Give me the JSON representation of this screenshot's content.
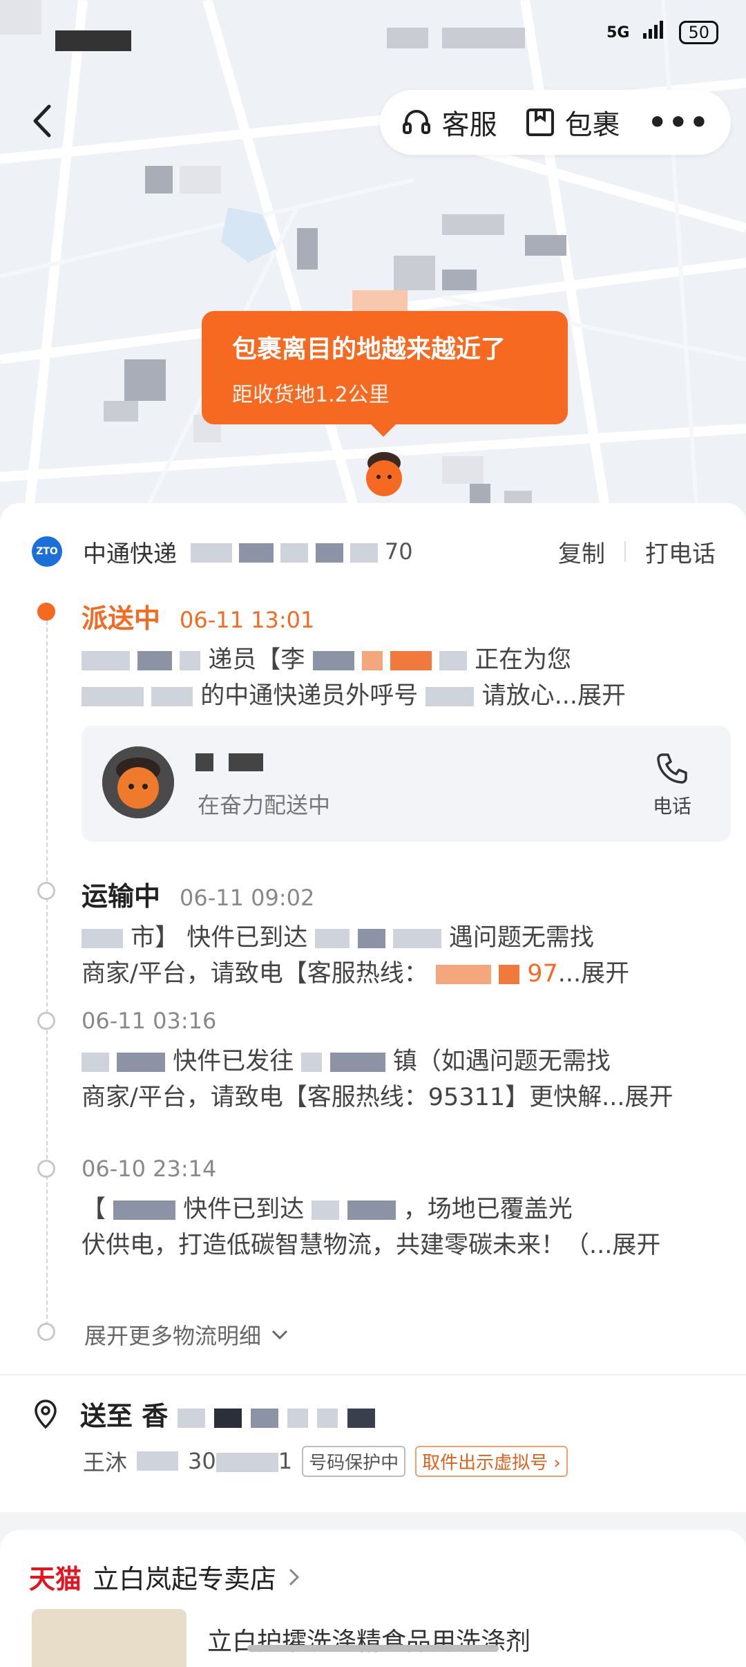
{
  "status_bar": {
    "network": "5G",
    "battery": "50"
  },
  "header": {
    "service_label": "客服",
    "package_label": "包裹",
    "more_label": "•••"
  },
  "map": {
    "bubble_title": "包裹离目的地越来越近了",
    "bubble_subtitle": "距收货地1.2公里"
  },
  "carrier": {
    "name": "中通快递",
    "tracking_suffix": "70",
    "copy_label": "复制",
    "call_label": "打电话",
    "logo_text": "ZTO"
  },
  "events": [
    {
      "status": "派送中",
      "time": "06-11 13:01",
      "line1_mid": "递员【李",
      "line1_end": "正在为您",
      "line2_mid": "的中通快递员外呼号",
      "line2_end": "请放心...展开"
    },
    {
      "status": "运输中",
      "time": "06-11 09:02",
      "line1_a": "市】",
      "line1_b": "快件已到达",
      "line1_c": "遇问题无需找",
      "line2_a": "商家/平台，请致电【客服热线：",
      "line2_b": "97",
      "line2_c": "...展开"
    },
    {
      "status": "",
      "time": "06-11 03:16",
      "line1_b": "快件已发往",
      "line1_c": "镇（如遇问题无需找",
      "line2_a": "商家/平台，请致电【客服热线：95311】更快解...展开"
    },
    {
      "status": "",
      "time": "06-10 23:14",
      "line1_a": "【",
      "line1_b": "快件已到达",
      "line1_c": "，场地已覆盖光",
      "line2_a": "伏供电，打造低碳智慧物流，共建零碳未来！（...展开"
    }
  ],
  "courier": {
    "status": "在奋力配送中",
    "phone_label": "电话"
  },
  "expand_more_label": "展开更多物流明细",
  "address": {
    "prefix": "送至",
    "province_start": "香",
    "receiver": "王沐",
    "phone_partial": "30",
    "phone_tail": "1",
    "tag_protect": "号码保护中",
    "tag_virtual": "取件出示虚拟号"
  },
  "store": {
    "platform": "天猫",
    "name": "立白岚起专卖店",
    "product_title": "立白护攉洗涤精食品用洗涤剂"
  },
  "colors": {
    "accent": "#f56a20",
    "tmall_red": "#e4151e",
    "zto_blue": "#1b6fd8"
  }
}
